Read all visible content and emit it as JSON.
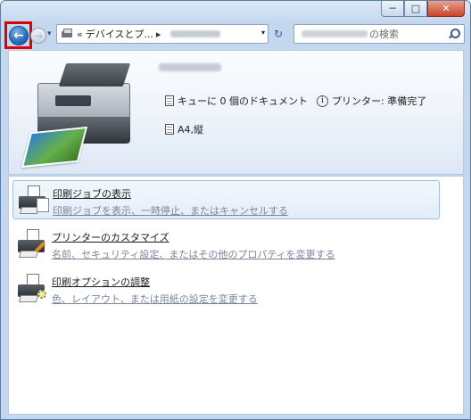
{
  "window": {
    "caption": {
      "minimize": "─",
      "maximize": "□",
      "close": "✕"
    }
  },
  "nav": {
    "back_glyph": "←",
    "forward_glyph": "→",
    "recent_glyph": "▾",
    "address": {
      "prefix": "«",
      "crumb": "デバイスとプ...",
      "separator": "▸",
      "dropdown": "▾"
    },
    "refresh_glyph": "↻",
    "search": {
      "suffix": "の検索"
    }
  },
  "header": {
    "queue_status": "キューに 0 個のドキュメント",
    "info_glyph": "i",
    "printer_status": "プリンター:  準備完了",
    "paper": "A4,縦"
  },
  "tasks": [
    {
      "title": "印刷ジョブの表示",
      "description": "印刷ジョブを表示、一時停止、またはキャンセルする"
    },
    {
      "title": "プリンターのカスタマイズ",
      "description": "名前、セキュリティ設定、またはその他のプロパティを変更する"
    },
    {
      "title": "印刷オプションの調整",
      "description": "色、レイアウト、または用紙の設定を変更する"
    }
  ],
  "colors": {
    "window_frame": "#c3d8ee",
    "highlight": "#e00000",
    "selection_border": "#9ebde3"
  }
}
